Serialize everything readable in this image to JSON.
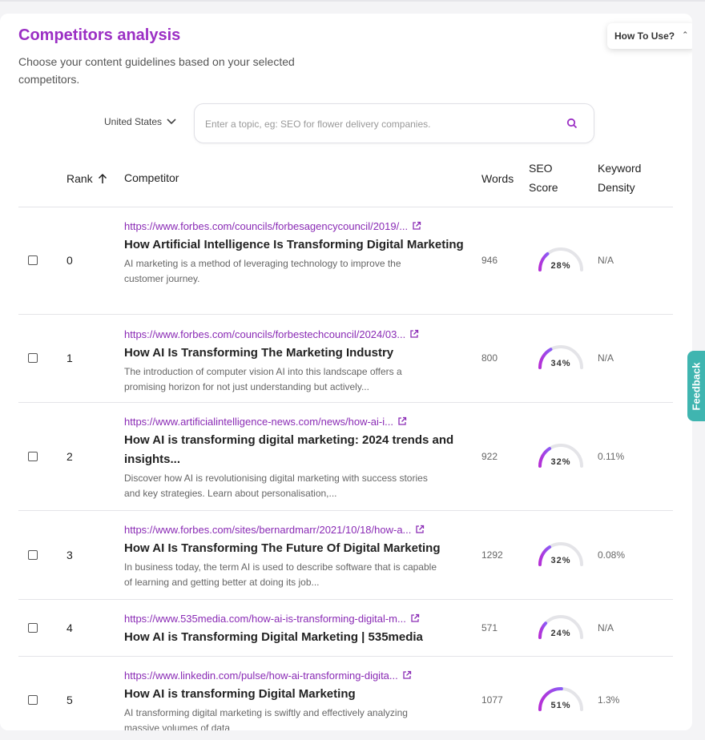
{
  "header": {
    "title": "Competitors analysis",
    "subtitle": "Choose your content guidelines based on your selected competitors.",
    "how_to_use": "How To Use?"
  },
  "search": {
    "country": "United States",
    "placeholder": "Enter a topic, eg: SEO for flower delivery companies.",
    "value": ""
  },
  "table": {
    "columns": {
      "rank": "Rank",
      "competitor": "Competitor",
      "words": "Words",
      "seo_score_1": "SEO",
      "seo_score_2": "Score",
      "keyword_density_1": "Keyword",
      "keyword_density_2": "Density"
    },
    "rows": [
      {
        "rank": "0",
        "url": "https://www.forbes.com/councils/forbesagencycouncil/2019/...",
        "title": "How Artificial Intelligence Is Transforming Digital Marketing",
        "description": "AI marketing is a method of leveraging technology to improve the customer journey.",
        "words": "946",
        "seo_score": 28,
        "seo_label": "28%",
        "keyword_density": "N/A"
      },
      {
        "rank": "1",
        "url": "https://www.forbes.com/councils/forbestechcouncil/2024/03...",
        "title": "How AI Is Transforming The Marketing Industry",
        "description": "The introduction of computer vision AI into this landscape offers a promising horizon for not just understanding but actively...",
        "words": "800",
        "seo_score": 34,
        "seo_label": "34%",
        "keyword_density": "N/A"
      },
      {
        "rank": "2",
        "url": "https://www.artificialintelligence-news.com/news/how-ai-i...",
        "title": "How AI is transforming digital marketing: 2024 trends and insights...",
        "description": "Discover how AI is revolutionising digital marketing with success stories and key strategies. Learn about personalisation,...",
        "words": "922",
        "seo_score": 32,
        "seo_label": "32%",
        "keyword_density": "0.11%"
      },
      {
        "rank": "3",
        "url": "https://www.forbes.com/sites/bernardmarr/2021/10/18/how-a...",
        "title": "How AI Is Transforming The Future Of Digital Marketing",
        "description": "In business today, the term AI is used to describe software that is capable of learning and getting better at doing its job...",
        "words": "1292",
        "seo_score": 32,
        "seo_label": "32%",
        "keyword_density": "0.08%"
      },
      {
        "rank": "4",
        "url": "https://www.535media.com/how-ai-is-transforming-digital-m...",
        "title": "How AI is Transforming Digital Marketing | 535media",
        "description": "",
        "words": "571",
        "seo_score": 24,
        "seo_label": "24%",
        "keyword_density": "N/A"
      },
      {
        "rank": "5",
        "url": "https://www.linkedin.com/pulse/how-ai-transforming-digita...",
        "title": "How AI is transforming Digital Marketing",
        "description": "AI transforming digital marketing is swiftly and effectively analyzing massive volumes of data",
        "words": "1077",
        "seo_score": 51,
        "seo_label": "51%",
        "keyword_density": "1.3%"
      }
    ]
  },
  "feedback": "Feedback",
  "colors": {
    "accent": "#9b2fc4",
    "link": "#8a2bb5",
    "gauge_track": "#e4e4e8",
    "feedback_bg": "#3fb5b0"
  },
  "icons": {
    "sort": "arrow-up-icon",
    "search": "search-icon",
    "external": "external-link-icon",
    "dropdown": "chevron-down-icon"
  }
}
